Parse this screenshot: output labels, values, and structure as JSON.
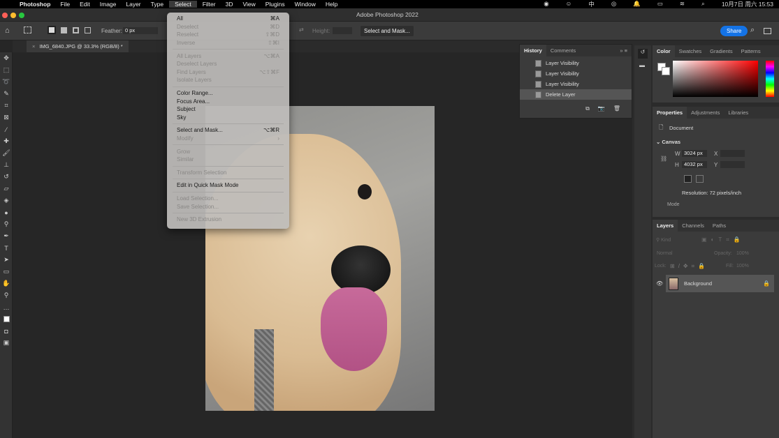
{
  "menubar": {
    "app": "Photoshop",
    "items": [
      "File",
      "Edit",
      "Image",
      "Layer",
      "Type",
      "Select",
      "Filter",
      "3D",
      "View",
      "Plugins",
      "Window",
      "Help"
    ],
    "clock": "10月7日 周六 15:53",
    "input_method": "中"
  },
  "window": {
    "title": "Adobe Photoshop 2022"
  },
  "options": {
    "feather_label": "Feather:",
    "feather_value": "0 px",
    "height_label": "Height:",
    "select_mask": "Select and Mask...",
    "share": "Share"
  },
  "document": {
    "tab": "IMG_6840.JPG @ 33.3% (RGB/8) *"
  },
  "select_menu": {
    "groups": [
      [
        {
          "label": "All",
          "shortcut": "⌘A",
          "enabled": true
        },
        {
          "label": "Deselect",
          "shortcut": "⌘D",
          "enabled": false
        },
        {
          "label": "Reselect",
          "shortcut": "⇧⌘D",
          "enabled": false
        },
        {
          "label": "Inverse",
          "shortcut": "⇧⌘I",
          "enabled": false
        }
      ],
      [
        {
          "label": "All Layers",
          "shortcut": "⌥⌘A",
          "enabled": false
        },
        {
          "label": "Deselect Layers",
          "shortcut": "",
          "enabled": false
        },
        {
          "label": "Find Layers",
          "shortcut": "⌥⇧⌘F",
          "enabled": false
        },
        {
          "label": "Isolate Layers",
          "shortcut": "",
          "enabled": false
        }
      ],
      [
        {
          "label": "Color Range...",
          "shortcut": "",
          "enabled": true
        },
        {
          "label": "Focus Area...",
          "shortcut": "",
          "enabled": true
        },
        {
          "label": "Subject",
          "shortcut": "",
          "enabled": true
        },
        {
          "label": "Sky",
          "shortcut": "",
          "enabled": true
        }
      ],
      [
        {
          "label": "Select and Mask...",
          "shortcut": "⌥⌘R",
          "enabled": true
        },
        {
          "label": "Modify",
          "shortcut": "›",
          "enabled": false
        }
      ],
      [
        {
          "label": "Grow",
          "shortcut": "",
          "enabled": false
        },
        {
          "label": "Similar",
          "shortcut": "",
          "enabled": false
        }
      ],
      [
        {
          "label": "Transform Selection",
          "shortcut": "",
          "enabled": false
        }
      ],
      [
        {
          "label": "Edit in Quick Mask Mode",
          "shortcut": "",
          "enabled": true
        }
      ],
      [
        {
          "label": "Load Selection...",
          "shortcut": "",
          "enabled": false
        },
        {
          "label": "Save Selection...",
          "shortcut": "",
          "enabled": false
        }
      ],
      [
        {
          "label": "New 3D Extrusion",
          "shortcut": "",
          "enabled": false
        }
      ]
    ]
  },
  "history": {
    "tabs": [
      "History",
      "Comments"
    ],
    "items": [
      "Layer Visibility",
      "Layer Visibility",
      "Layer Visibility",
      "Delete Layer"
    ],
    "selected": 3
  },
  "color_panel": {
    "tabs": [
      "Color",
      "Swatches",
      "Gradients",
      "Patterns"
    ],
    "hue": "#ff0000"
  },
  "properties": {
    "tabs": [
      "Properties",
      "Adjustments",
      "Libraries"
    ],
    "doc_label": "Document",
    "section": "Canvas",
    "w_label": "W",
    "w": "3024 px",
    "h_label": "H",
    "h": "4032 px",
    "x_label": "X",
    "y_label": "Y",
    "resolution": "Resolution: 72 pixels/inch",
    "mode": "Mode"
  },
  "layers": {
    "tabs": [
      "Layers",
      "Channels",
      "Paths"
    ],
    "kind": "Kind",
    "blend": "Normal",
    "opacity_label": "Opacity:",
    "opacity": "100%",
    "lock_label": "Lock:",
    "fill_label": "Fill:",
    "fill": "100%",
    "items": [
      {
        "name": "Background",
        "visible": true,
        "locked": true
      }
    ]
  }
}
